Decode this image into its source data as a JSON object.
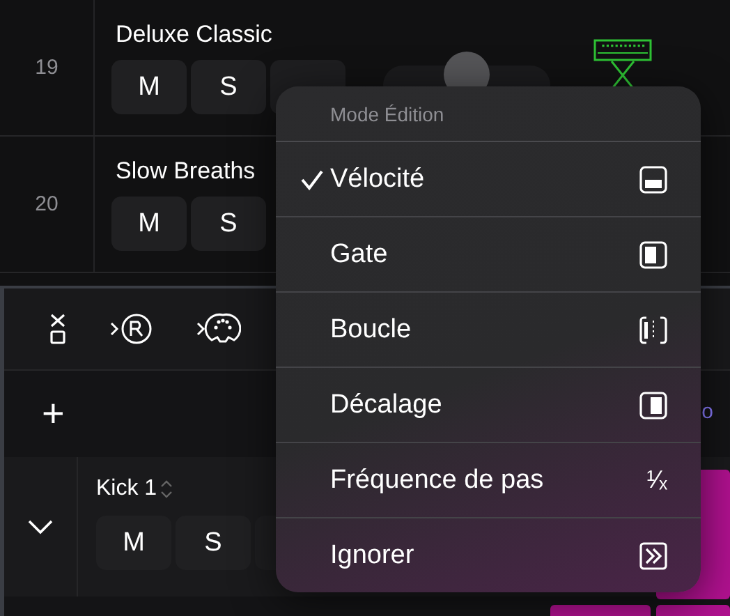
{
  "tracks": [
    {
      "number": "19",
      "name": "Deluxe Classic",
      "buttons": [
        "M",
        "S"
      ],
      "covered_button": true,
      "level": 0.5
    },
    {
      "number": "20",
      "name": "Slow Breaths",
      "buttons": [
        "M",
        "S"
      ]
    }
  ],
  "toolbar": {
    "add": "+"
  },
  "pattern_track": {
    "name": "Kick 1",
    "buttons": [
      "M",
      "S"
    ],
    "expanded": true,
    "fragment": "o"
  },
  "menu": {
    "title": "Mode Édition",
    "items": [
      {
        "label": "Vélocité",
        "selected": true,
        "kind": "velocity"
      },
      {
        "label": "Gate",
        "selected": false,
        "kind": "gate"
      },
      {
        "label": "Boucle",
        "selected": false,
        "kind": "loop"
      },
      {
        "label": "Décalage",
        "selected": false,
        "kind": "offset"
      },
      {
        "label": "Fréquence de pas",
        "selected": false,
        "kind": "rate",
        "icon_text": "¹⁄ₓ"
      },
      {
        "label": "Ignorer",
        "selected": false,
        "kind": "skip"
      }
    ]
  }
}
